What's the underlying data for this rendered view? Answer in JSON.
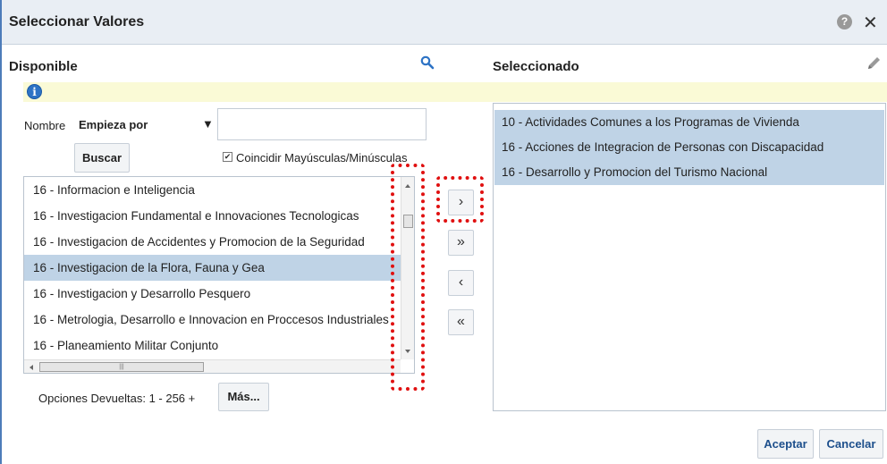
{
  "dialog": {
    "title": "Seleccionar Valores",
    "help_icon": "help-icon",
    "close_icon": "close-icon",
    "help_glyph": "?",
    "close_glyph": "✕"
  },
  "available": {
    "heading": "Disponible",
    "search_icon": "search-icon",
    "info_icon": "info-icon",
    "info_glyph": "i",
    "name_label": "Nombre",
    "operator_value": "Empieza por",
    "search_input_value": "",
    "search_button": "Buscar",
    "match_case_label": "Coincidir Mayúsculas/Minúsculas",
    "match_case_checked": true,
    "items": [
      "16 - Informacion e Inteligencia",
      "16 - Investigacion Fundamental e Innovaciones Tecnologicas",
      "16 - Investigacion de Accidentes y Promocion de la Seguridad",
      "16 - Investigacion de la Flora, Fauna y Gea",
      "16 - Investigacion y Desarrollo Pesquero",
      "16 - Metrologia, Desarrollo e Innovacion en Proccesos Industriales",
      "16 - Planeamiento Militar Conjunto"
    ],
    "selected_index": 3,
    "returned_label": "Opciones Devueltas: 1 - 256 +",
    "more_button": "Más..."
  },
  "selected": {
    "heading": "Seleccionado",
    "edit_icon": "pencil-icon",
    "items": [
      "10 - Actividades Comunes a los Programas de Vivienda",
      "16 - Acciones de Integracion de Personas con Discapacidad",
      "16 - Desarrollo y Promocion del Turismo Nacional"
    ]
  },
  "move_buttons": {
    "move_glyph": "›",
    "move_all_glyph": "»",
    "remove_glyph": "‹",
    "remove_all_glyph": "«"
  },
  "footer": {
    "accept_button": "Aceptar",
    "cancel_button": "Cancelar"
  },
  "colors": {
    "selected_row": "#bfd3e6",
    "info_bar": "#fafad6",
    "annotation": "#e01010",
    "accent": "#2d73c5"
  }
}
